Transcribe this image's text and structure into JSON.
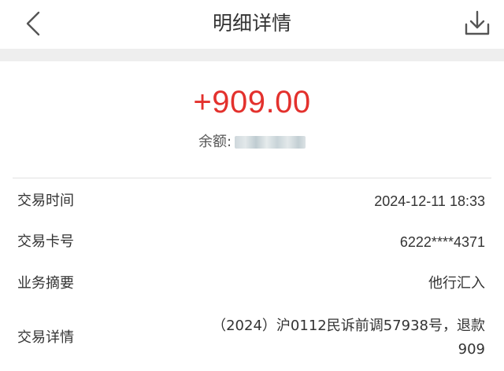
{
  "header": {
    "title": "明细详情",
    "back_icon": "chevron-left-icon",
    "download_icon": "download-icon"
  },
  "amount": "+909.00",
  "balance": {
    "label": "余额:"
  },
  "details": [
    {
      "label": "交易时间",
      "value": "2024-12-11 18:33"
    },
    {
      "label": "交易卡号",
      "value": "6222****4371"
    },
    {
      "label": "业务摘要",
      "value": "他行汇入"
    },
    {
      "label": "交易详情",
      "value": "（2024）沪0112民诉前调57938号，退款909"
    }
  ],
  "colors": {
    "amount": "#e3312d",
    "band": "#eeeeee",
    "text": "#333333"
  }
}
